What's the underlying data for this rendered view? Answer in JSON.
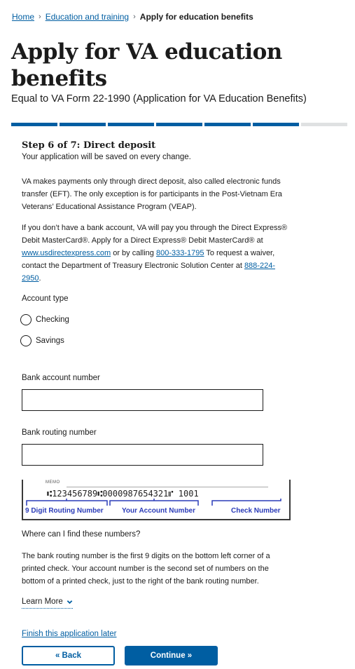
{
  "breadcrumb": {
    "items": [
      "Home",
      "Education and training"
    ],
    "current": "Apply for education benefits",
    "separator": "›"
  },
  "page": {
    "title": "Apply for VA education benefits",
    "subtitle": "Equal to VA Form 22-1990 (Application for VA Education Benefits)"
  },
  "progress": {
    "current_step": 6,
    "total_steps": 7,
    "complete_color": "#005ea2",
    "incomplete_color": "#dfe1e2"
  },
  "step": {
    "heading": "Step 6 of 7: Direct deposit",
    "autosave_note": "Your application will be saved on every change."
  },
  "content": {
    "eft_paragraph": "VA makes payments only through direct deposit, also called electronic funds transfer (EFT). The only exception is for participants in the Post-Vietnam Era Veterans’ Educational Assistance Program (VEAP).",
    "no_bank_text_1": "If you don’t have a bank account, VA will pay you through the Direct Express® Debit MasterCard®. Apply for a Direct Express® Debit MasterCard® at ",
    "direct_express_link": "www.usdirectexpress.com",
    "no_bank_text_2": " or by calling ",
    "phone_link": "800-333-1795",
    "no_bank_text_3": " To request a waiver, contact the Department of Treasury Electronic Solution Center at ",
    "treasury_phone_link": "888-224-2950",
    "no_bank_text_4": "."
  },
  "form": {
    "account_type_label": "Account type",
    "account_type_options": [
      "Checking",
      "Savings"
    ],
    "bank_account_label": "Bank account number",
    "bank_account_value": "",
    "routing_label": "Bank routing number",
    "routing_value": ""
  },
  "check_image": {
    "memo": "MEMO",
    "micr_line": "⑆123456789⑆0000987654321⑈   1001",
    "routing_caption": "9 Digit Routing Number",
    "account_caption": "Your Account Number",
    "check_caption": "Check Number"
  },
  "help": {
    "question": "Where can I find these numbers?",
    "answer": "The bank routing number is the first 9 digits on the bottom left corner of a printed check. Your account number is the second set of numbers on the bottom of a printed check, just to the right of the bank routing number.",
    "learn_more": "Learn More",
    "learn_more_icon": "chevron-down-icon"
  },
  "footer": {
    "finish_later": "Finish this application later",
    "back_label": "« Back",
    "continue_label": "Continue »"
  }
}
